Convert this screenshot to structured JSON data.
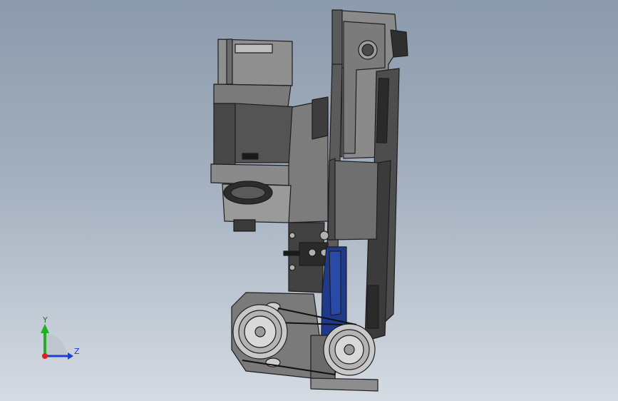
{
  "triad": {
    "x_label": "",
    "y_label": "Y",
    "z_label": "Z",
    "colors": {
      "x": "#e02020",
      "y": "#22b022",
      "z": "#1c3fd8"
    }
  },
  "model": {
    "parts": [
      "stepper-motor",
      "motor-mount-bracket",
      "coupling",
      "linear-rail-plate",
      "slider-block",
      "blue-guard",
      "belt-pulley-large",
      "belt-pulley-small",
      "drive-belt",
      "tensioner-bracket",
      "top-bracket"
    ],
    "colors": {
      "body": "#6e6e6e",
      "dark": "#3a3a3a",
      "light": "#9a9a9a",
      "edge": "#1e1e1e",
      "guard": "#1f3a8a",
      "pulley": "#c9c9c9"
    }
  }
}
